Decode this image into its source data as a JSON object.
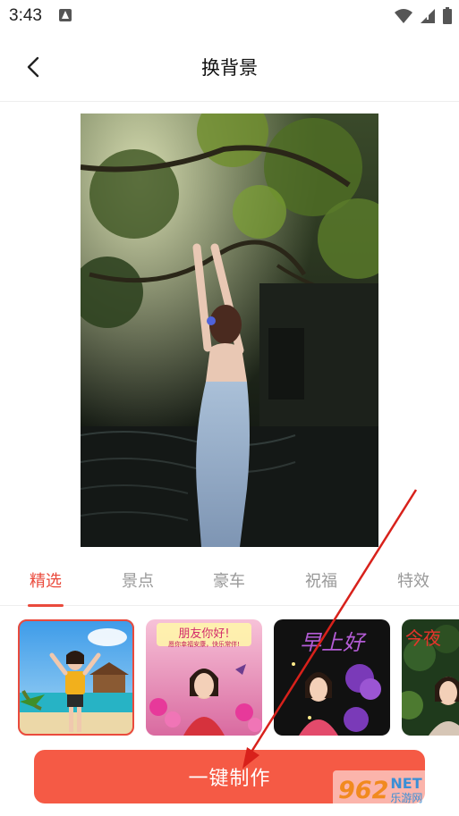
{
  "status_bar": {
    "time": "3:43"
  },
  "header": {
    "title": "换背景"
  },
  "tabs": [
    {
      "label": "精选",
      "active": true
    },
    {
      "label": "景点",
      "active": false
    },
    {
      "label": "豪车",
      "active": false
    },
    {
      "label": "祝福",
      "active": false
    },
    {
      "label": "特效",
      "active": false
    }
  ],
  "templates": [
    {
      "kind": "beach",
      "selected": true
    },
    {
      "kind": "greeting",
      "heading": "朋友你好!",
      "subtext": "愿你幸福安康，快乐常伴!"
    },
    {
      "kind": "morning",
      "heading": "早上好"
    },
    {
      "kind": "night",
      "heading": "今夜"
    }
  ],
  "cta": {
    "label": "一键制作"
  },
  "watermark": {
    "number": "962",
    "domain": "NET",
    "site": "乐游网"
  },
  "colors": {
    "accent": "#ea4a3c",
    "cta": "#f55a45",
    "tab_inactive": "#999999"
  }
}
